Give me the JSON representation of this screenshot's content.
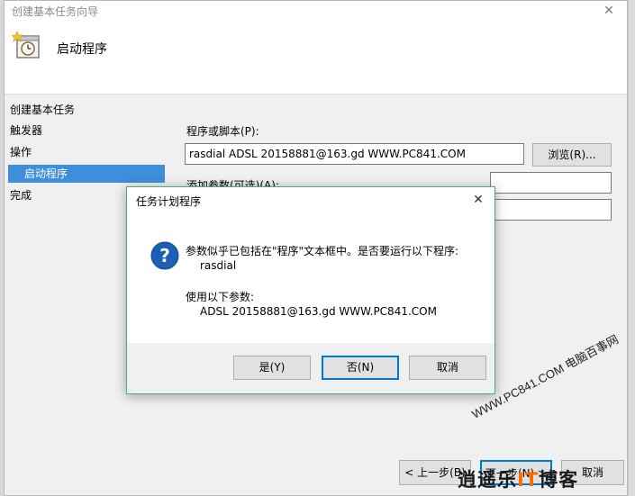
{
  "wizard": {
    "title": "创建基本任务向导",
    "close_glyph": "✕",
    "header_title": "启动程序",
    "nav": {
      "heading": "创建基本任务",
      "items": [
        {
          "label": "触发器"
        },
        {
          "label": "操作"
        },
        {
          "label": "启动程序"
        },
        {
          "label": "完成"
        }
      ]
    },
    "form": {
      "program_label": "程序或脚本(P):",
      "program_value": "rasdial ADSL 20158881@163.gd WWW.PC841.COM",
      "browse_label": "浏览(R)...",
      "args_label": "添加参数(可选)(A):"
    },
    "footer": {
      "back_label": "< 上一步(B)",
      "next_label": "下一步(N) >",
      "cancel_label": "取消"
    }
  },
  "dialog": {
    "title": "任务计划程序",
    "close_glyph": "✕",
    "message_line1": "参数似乎已包括在\"程序\"文本框中。是否要运行以下程序:",
    "program_name": "rasdial",
    "message_line3": "使用以下参数:",
    "arguments": "ADSL 20158881@163.gd WWW.PC841.COM",
    "buttons": {
      "yes": "是(Y)",
      "no": "否(N)",
      "cancel": "取消"
    },
    "icon": "question-icon"
  },
  "watermark": {
    "diagonal_text": "WWW.PC841.COM 电脑百事网",
    "logo_text_part1": "逍遥乐",
    "logo_text_it": "IT",
    "logo_text_part2": "博客"
  },
  "colors": {
    "selection": "#3e8edc",
    "dialog_border": "#4caf6d",
    "default_button_border": "#0078d7",
    "logo_accent": "#ff6a00"
  }
}
